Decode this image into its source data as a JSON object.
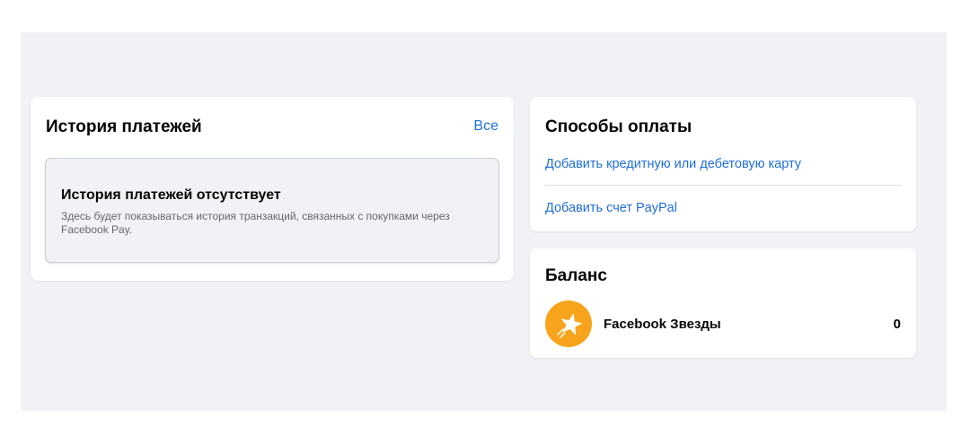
{
  "payment_history": {
    "title": "История платежей",
    "see_all_label": "Все",
    "empty": {
      "title": "История платежей отсутствует",
      "description": "Здесь будет показываться история транзакций, связанных с покупками через Facebook Pay."
    }
  },
  "payment_methods": {
    "title": "Способы оплаты",
    "add_card_label": "Добавить кредитную или дебетовую карту",
    "add_paypal_label": "Добавить счет PayPal"
  },
  "balance": {
    "title": "Баланс",
    "stars": {
      "label": "Facebook Звезды",
      "count": "0",
      "icon": "facebook-stars-icon",
      "icon_color": "#f7a41c"
    }
  },
  "colors": {
    "link": "#216fdb",
    "page_background": "#f0f2f5",
    "card_background": "#ffffff"
  }
}
